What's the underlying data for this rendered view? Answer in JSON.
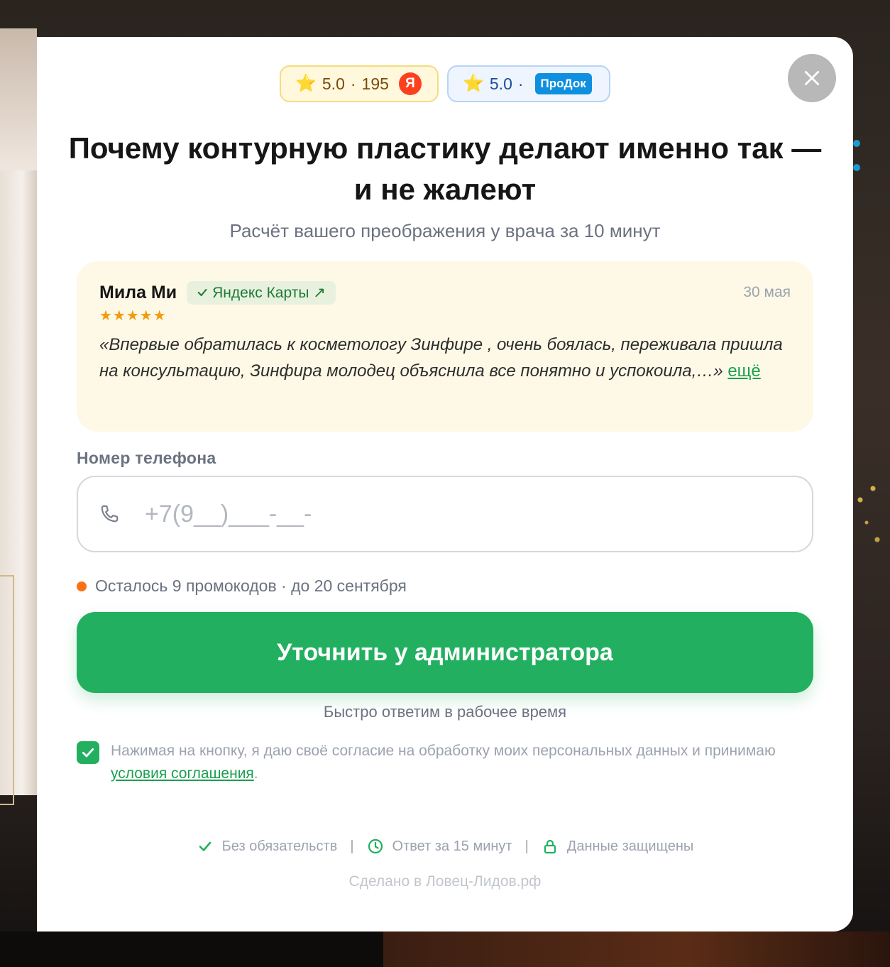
{
  "modal": {
    "ratings": {
      "yandex": {
        "value": "5.0",
        "separator": "·",
        "count": "195",
        "logo_letter": "Я"
      },
      "prodoctorov": {
        "value": "5.0",
        "separator": "·",
        "logo_text": "ПроДок"
      }
    },
    "title": "Почему контурную пластику делают именно так — и не жалеют",
    "subtitle": "Расчёт вашего преображения у врача за 10 минут",
    "review": {
      "author": "Мила Ми",
      "source": "Яндекс Карты ↗",
      "date": "30 мая",
      "stars": "★★★★★",
      "rating": 5,
      "text": "«Впервые обратилась к косметологу Зинфире , очень боялась, переживала пришла на консультацию, Зинфира молодец объяснила все понятно и успокоила,…»",
      "more_link": "ещё"
    },
    "phone": {
      "label": "Номер телефона",
      "placeholder": "+7(9__)___-__-",
      "value": ""
    },
    "promo": "Осталось 9 промокодов · до 20 сентября",
    "cta_label": "Уточнить у администратора",
    "cta_note": "Быстро ответим в рабочее время",
    "consent": {
      "checked": true,
      "text": "Нажимая на кнопку, я даю своё согласие на обработку моих персональных данных и принимаю ",
      "link": "условия соглашения",
      "end": "."
    },
    "trust": [
      {
        "icon": "check-icon",
        "label": "Без обязательств"
      },
      {
        "icon": "clock-icon",
        "label": "Ответ за 15 минут"
      },
      {
        "icon": "lock-icon",
        "label": "Данные защищены"
      }
    ],
    "trust_separator": "|",
    "made_by": "Сделано в Ловец-Лидов.рф"
  },
  "colors": {
    "accent_green": "#22b060",
    "promo_dot": "#f97316",
    "yandex_red": "#fc3f1d",
    "prodoc_blue": "#0e8fe0",
    "review_bg": "#fef9e7"
  }
}
